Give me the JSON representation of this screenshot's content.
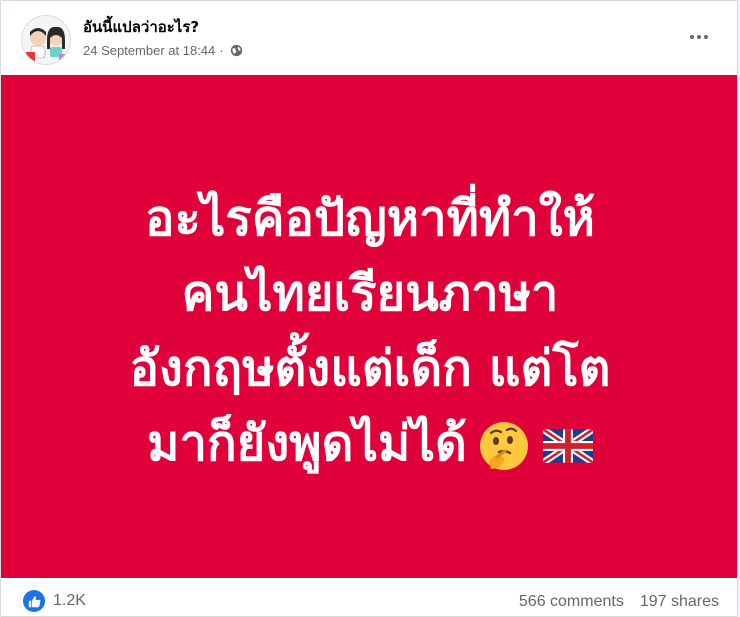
{
  "post": {
    "page_name": "อันนี้แปลว่าอะไร?",
    "timestamp": "24 September at 18:44",
    "separator": "·",
    "audience_icon": "globe-icon",
    "more_icon": "more-options-icon"
  },
  "image": {
    "background_color": "#e0003a",
    "text_color": "#ffffff",
    "lines": [
      "อะไรคือปัญหาที่ทำให้",
      "คนไทยเรียนภาษา",
      "อังกฤษตั้งแต่เด็ก แต่โต",
      "มาก็ยังพูดไม่ได้"
    ],
    "emojis": [
      "thinking-face-icon",
      "uk-flag-icon"
    ]
  },
  "footer": {
    "reaction_icon": "like-icon",
    "reaction_count": "1.2K",
    "comments": "566 comments",
    "shares": "197 shares"
  }
}
